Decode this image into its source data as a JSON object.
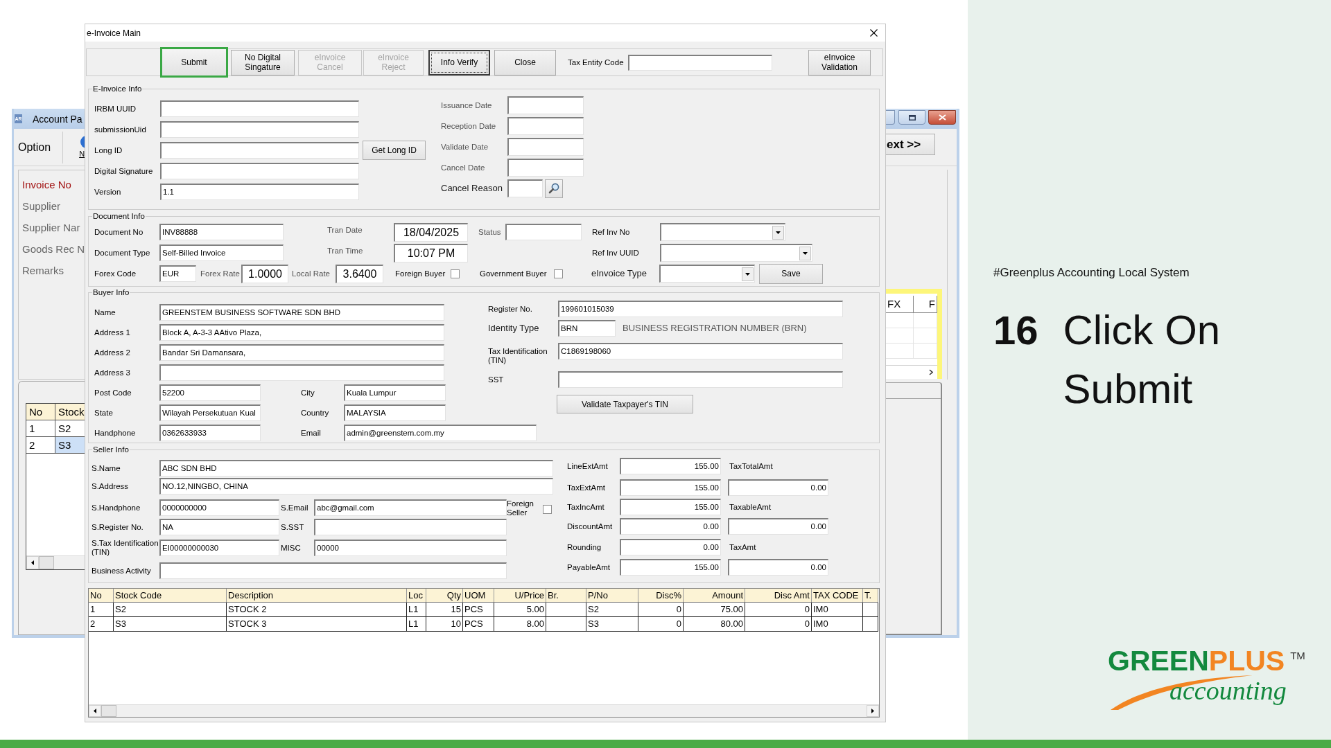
{
  "background_window": {
    "app_icon": "AR",
    "title": "Account Pa",
    "toolbar": {
      "option_label": "Option",
      "button_label": "N",
      "next_button": "ext >>"
    },
    "search_fields": [
      {
        "label": "Invoice No",
        "selected": true
      },
      {
        "label": "Supplier",
        "selected": false
      },
      {
        "label": "Supplier Nar",
        "selected": false
      },
      {
        "label": "Goods Rec N",
        "selected": false
      },
      {
        "label": "Remarks",
        "selected": false
      }
    ],
    "items_grid": {
      "columns": [
        "No",
        "Stock"
      ],
      "rows": [
        {
          "cells": [
            "1",
            "S2"
          ],
          "selected": false
        },
        {
          "cells": [
            "2",
            "S3"
          ],
          "selected": true
        }
      ]
    },
    "side_grid": {
      "columns": [
        "FX",
        "F"
      ]
    }
  },
  "dialog": {
    "title": "e-Invoice Main",
    "toolbar": {
      "buttons": [
        {
          "label": "Submit",
          "highlighted": true,
          "disabled": false,
          "focused": false
        },
        {
          "label": "No Digital Singature",
          "highlighted": false,
          "disabled": false,
          "focused": false
        },
        {
          "label": "eInvoice Cancel",
          "highlighted": false,
          "disabled": true,
          "focused": false
        },
        {
          "label": "eInvoice Reject",
          "highlighted": false,
          "disabled": true,
          "focused": false
        },
        {
          "label": "Info Verify",
          "highlighted": false,
          "disabled": false,
          "focused": true
        },
        {
          "label": "Close",
          "highlighted": false,
          "disabled": false,
          "focused": false
        }
      ],
      "tax_entity_code": {
        "label": "Tax Entity Code"
      },
      "validation_button": "eInvoice Validation"
    },
    "einvoice_info": {
      "title": "E-Invoice Info",
      "fields": [
        {
          "label": "IRBM UUID"
        },
        {
          "label": "submissionUid"
        },
        {
          "label": "Long ID",
          "button": "Get Long ID"
        },
        {
          "label": "Digital Signature"
        },
        {
          "label": "Version",
          "value": "1.1"
        }
      ],
      "dates": [
        {
          "label": "Issuance Date",
          "kind": "text"
        },
        {
          "label": "Reception Date",
          "kind": "text"
        },
        {
          "label": "Validate Date",
          "kind": "text"
        },
        {
          "label": "Cancel Date",
          "kind": "text"
        },
        {
          "label": "Cancel Reason",
          "kind": "lookup"
        }
      ]
    },
    "document_info": {
      "title": "Document Info",
      "document_no": {
        "label": "Document No",
        "value": "INV88888"
      },
      "tran_date": {
        "label": "Tran Date",
        "value": "18/04/2025"
      },
      "status": {
        "label": "Status"
      },
      "ref_inv_no": {
        "label": "Ref Inv No"
      },
      "document_type": {
        "label": "Document Type",
        "value": "Self-Billed Invoice"
      },
      "tran_time": {
        "label": "Tran Time",
        "value": "10:07 PM"
      },
      "ref_inv_uuid": {
        "label": "Ref Inv UUID"
      },
      "forex_code": {
        "label": "Forex Code",
        "value": "EUR"
      },
      "forex_rate": {
        "label": "Forex Rate",
        "value": "1.0000"
      },
      "local_rate": {
        "label": "Local Rate",
        "value": "3.6400"
      },
      "foreign_buyer": {
        "label": "Foreign Buyer",
        "checked": false
      },
      "government_buyer": {
        "label": "Government Buyer",
        "checked": false
      },
      "einvoice_type": {
        "label": "eInvoice Type"
      },
      "save_button": "Save"
    },
    "buyer_info": {
      "title": "Buyer Info",
      "name": {
        "label": "Name",
        "value": "GREENSTEM BUSINESS SOFTWARE SDN BHD"
      },
      "address_1": {
        "label": "Address 1",
        "value": "Block A, A-3-3 AAtivo Plaza,"
      },
      "address_2": {
        "label": "Address 2",
        "value": "Bandar Sri Damansara,"
      },
      "address_3": {
        "label": "Address 3"
      },
      "post_code": {
        "label": "Post Code",
        "value": "52200"
      },
      "city": {
        "label": "City",
        "value": "Kuala Lumpur"
      },
      "state": {
        "label": "State",
        "value": "Wilayah Persekutuan Kual"
      },
      "country": {
        "label": "Country",
        "value": "MALAYSIA"
      },
      "handphone": {
        "label": "Handphone",
        "value": "0362633933"
      },
      "email": {
        "label": "Email",
        "value": "admin@greenstem.com.my"
      },
      "register_no": {
        "label": "Register No.",
        "value": "199601015039"
      },
      "identity_type": {
        "label": "Identity Type",
        "value": "BRN",
        "description": "BUSINESS REGISTRATION NUMBER (BRN)"
      },
      "tin": {
        "label": "Tax Identification (TIN)",
        "value": "C1869198060"
      },
      "sst": {
        "label": "SST"
      },
      "validate_button": "Validate Taxpayer's TIN"
    },
    "seller_info": {
      "title": "Seller Info",
      "name": {
        "label": "S.Name",
        "value": "ABC SDN BHD"
      },
      "address": {
        "label": "S.Address",
        "value": "NO.12,NINGBO, CHINA"
      },
      "handphone": {
        "label": "S.Handphone",
        "value": "0000000000"
      },
      "email": {
        "label": "S.Email",
        "value": "abc@gmail.com"
      },
      "foreign_seller": {
        "label": "Foreign Seller",
        "checked": false
      },
      "register_no": {
        "label": "S.Register No.",
        "value": "NA"
      },
      "sst": {
        "label": "S.SST"
      },
      "tin": {
        "label": "S.Tax Identification (TIN)",
        "value": "EI00000000030"
      },
      "misc": {
        "label": "MISC",
        "value": "00000"
      },
      "business_activity": {
        "label": "Business Activity"
      },
      "amounts": [
        {
          "label": "LineExtAmt",
          "value": "155.00"
        },
        {
          "label": "TaxExtAmt",
          "value": "155.00"
        },
        {
          "label": "TaxIncAmt",
          "value": "155.00"
        },
        {
          "label": "DiscountAmt",
          "value": "0.00"
        },
        {
          "label": "Rounding",
          "value": "0.00"
        },
        {
          "label": "PayableAmt",
          "value": "155.00"
        }
      ],
      "tax_amounts": [
        {
          "label": "TaxTotalAmt",
          "value": "0.00"
        },
        {
          "label": "TaxableAmt",
          "value": "0.00"
        },
        {
          "label": "TaxAmt",
          "value": "0.00"
        }
      ]
    },
    "items_table": {
      "columns": [
        "No",
        "Stock Code",
        "Description",
        "Loc",
        "Qty",
        "UOM",
        "U/Price",
        "Br.",
        "P/No",
        "Disc%",
        "Amount",
        "Disc Amt",
        "TAX CODE",
        "T."
      ],
      "rows": [
        [
          "1",
          "S2",
          "STOCK 2",
          "L1",
          "15",
          "PCS",
          "5.00",
          null,
          "S2",
          "0",
          "75.00",
          "0",
          "IM0"
        ],
        [
          "2",
          "S3",
          "STOCK 3",
          "L1",
          "10",
          "PCS",
          "8.00",
          null,
          "S3",
          "0",
          "80.00",
          "0",
          "IM0"
        ]
      ]
    }
  },
  "slide": {
    "hashtag": "#Greenplus Accounting Local System",
    "step_number": "16",
    "step_title": "Click On Submit",
    "logo": {
      "wordmark": [
        {
          "text": "GREEN",
          "color": "#13893e"
        },
        {
          "text": "PLUS",
          "color": "#f28522"
        }
      ],
      "trademark": "TM",
      "tagline": "accounting"
    }
  }
}
